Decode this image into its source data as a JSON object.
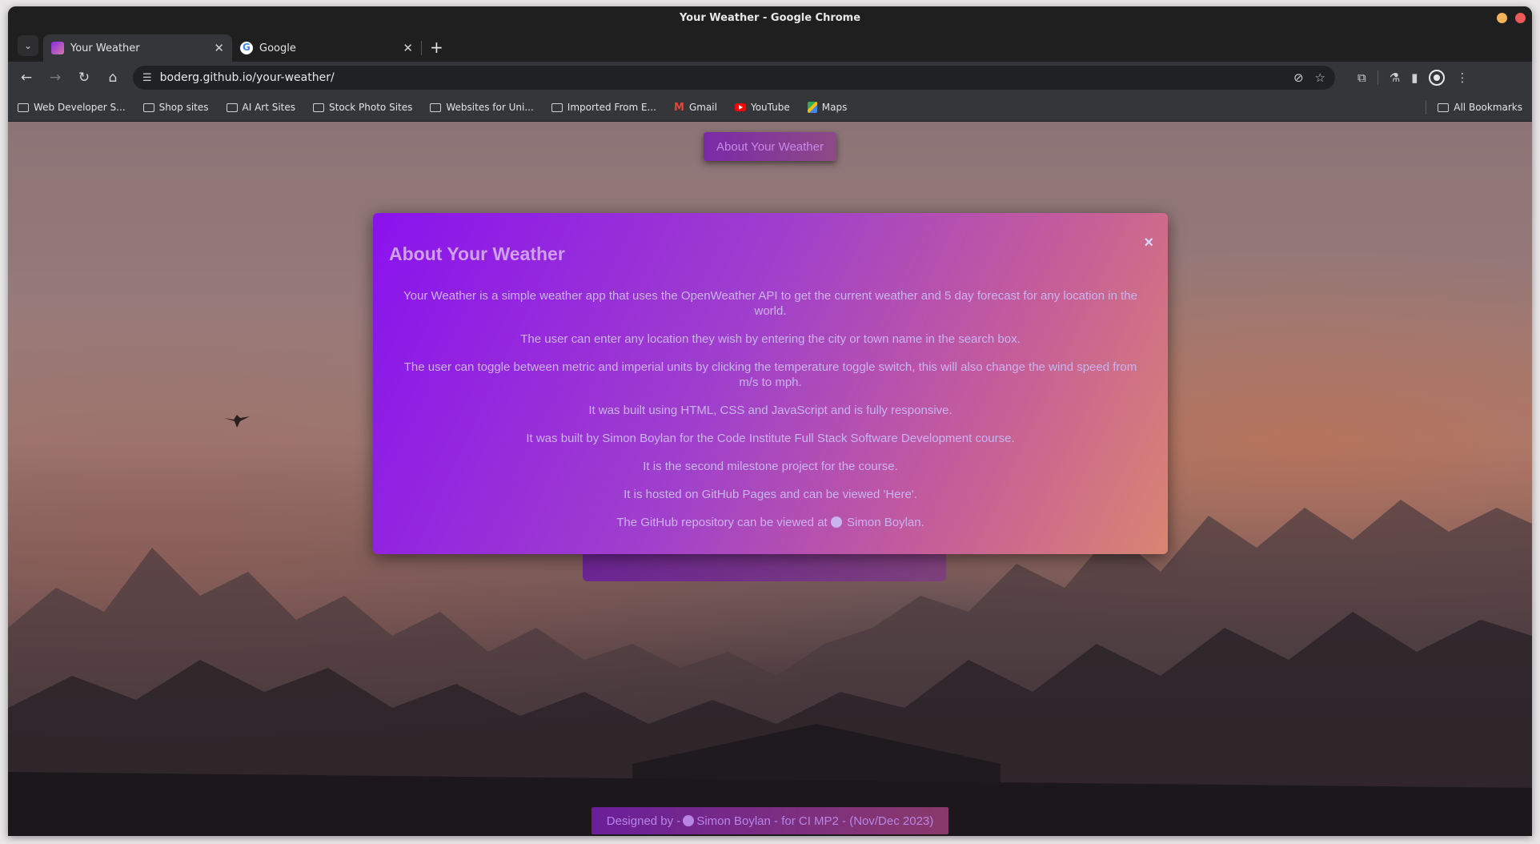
{
  "window": {
    "title": "Your Weather - Google Chrome"
  },
  "tabs": [
    {
      "label": "Your Weather",
      "active": true,
      "icon": "weather-favicon"
    },
    {
      "label": "Google",
      "active": false,
      "icon": "google-favicon"
    }
  ],
  "toolbar": {
    "url": "boderg.github.io/your-weather/"
  },
  "bookmarks": {
    "items": [
      {
        "label": "Web Developer S...",
        "icon": "folder-icon"
      },
      {
        "label": "Shop sites",
        "icon": "folder-icon"
      },
      {
        "label": "AI Art Sites",
        "icon": "folder-icon"
      },
      {
        "label": "Stock Photo Sites",
        "icon": "folder-icon"
      },
      {
        "label": "Websites for Uni...",
        "icon": "folder-icon"
      },
      {
        "label": "Imported From E...",
        "icon": "folder-icon"
      },
      {
        "label": "Gmail",
        "icon": "gmail-icon"
      },
      {
        "label": "YouTube",
        "icon": "youtube-icon"
      },
      {
        "label": "Maps",
        "icon": "maps-icon"
      }
    ],
    "all_label": "All Bookmarks"
  },
  "page": {
    "about_button": "About Your Weather",
    "modal": {
      "title": "About Your Weather",
      "close": "×",
      "paragraphs": [
        "Your Weather is a simple weather app that uses the OpenWeather API to get the current weather and 5 day forecast for any location in the world.",
        "The user can enter any location they wish by entering the city or town name in the search box.",
        "The user can toggle between metric and imperial units by clicking the temperature toggle switch, this will also change the wind speed from m/s to mph.",
        "It was built using HTML, CSS and JavaScript and is fully responsive.",
        "It was built by Simon Boylan for the Code Institute Full Stack Software Development course.",
        "It is the second milestone project for the course.",
        "It is hosted on GitHub Pages and can be viewed 'Here'."
      ],
      "repo_prefix": "The GitHub repository can be viewed at",
      "repo_link": "Simon Boylan."
    },
    "footer": {
      "prefix": "Designed by -",
      "suffix": "Simon Boylan - for CI MP2 - (Nov/Dec 2023)"
    }
  },
  "colors": {
    "modal_start": "#8a12ee",
    "modal_end": "#d98572",
    "modal_text": "#c9b4f0",
    "modal_title": "#cf9ff2"
  }
}
